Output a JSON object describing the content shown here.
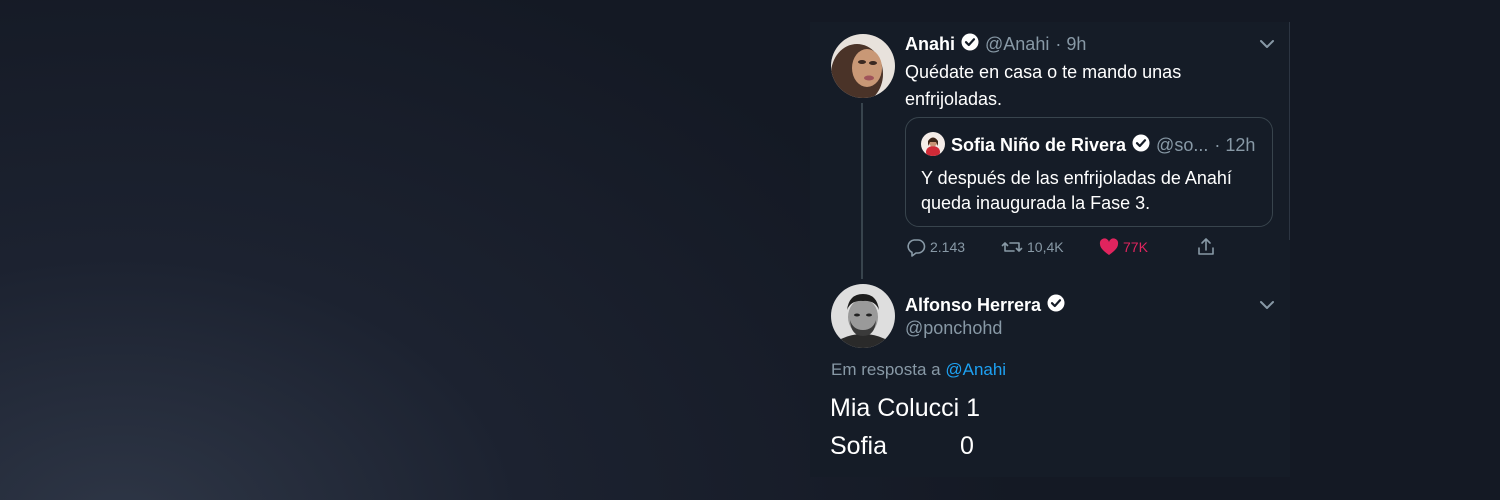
{
  "tweet1": {
    "author_name": "Anahi",
    "handle": "@Anahi",
    "time": "· 9h",
    "text_line1": "Quédate en casa o te mando unas",
    "text_line2": "enfrijoladas."
  },
  "quote": {
    "author_name": "Sofia Niño de Rivera",
    "handle": "@so...",
    "time": "· 12h",
    "text_line1": "Y después de las enfrijoladas de Anahí",
    "text_line2": "queda inaugurada la Fase 3."
  },
  "actions": {
    "replies": "2.143",
    "retweets": "10,4K",
    "likes": "77K"
  },
  "tweet2": {
    "author_name": "Alfonso Herrera",
    "handle": "@ponchohd",
    "reply_prefix": "Em resposta a",
    "reply_to": "@Anahi",
    "score_name1": "Mia Colucci",
    "score_val1": "1",
    "score_name2": "Sofia",
    "score_val2": "0"
  },
  "colors": {
    "link_blue": "#1da1f2",
    "like_red": "#e0245e",
    "muted": "#8899a6"
  },
  "icons": [
    "verified-badge-icon",
    "chevron-down-icon",
    "reply-icon",
    "retweet-icon",
    "heart-icon",
    "share-icon"
  ]
}
